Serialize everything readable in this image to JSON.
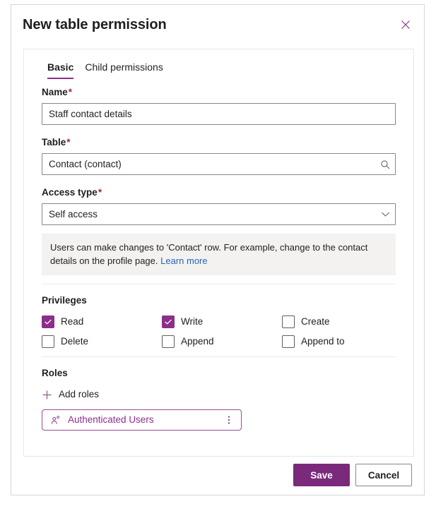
{
  "dialog": {
    "title": "New table permission",
    "close_icon": "close-icon"
  },
  "tabs": [
    {
      "label": "Basic",
      "active": true
    },
    {
      "label": "Child permissions",
      "active": false
    }
  ],
  "form": {
    "name": {
      "label": "Name",
      "required": "*",
      "value": "Staff contact details"
    },
    "table": {
      "label": "Table",
      "required": "*",
      "value": "Contact (contact)",
      "icon": "search-icon"
    },
    "access_type": {
      "label": "Access type",
      "required": "*",
      "value": "Self access",
      "icon": "chevron-down-icon"
    },
    "info": {
      "text": "Users can make changes to 'Contact' row. For example, change to the contact details on the profile page.",
      "link_label": "Learn more"
    }
  },
  "privileges": {
    "title": "Privileges",
    "items": [
      {
        "label": "Read",
        "checked": true
      },
      {
        "label": "Write",
        "checked": true
      },
      {
        "label": "Create",
        "checked": false
      },
      {
        "label": "Delete",
        "checked": false
      },
      {
        "label": "Append",
        "checked": false
      },
      {
        "label": "Append to",
        "checked": false
      }
    ]
  },
  "roles": {
    "title": "Roles",
    "add_label": "Add roles",
    "add_icon": "plus-icon",
    "chips": [
      {
        "label": "Authenticated Users",
        "icon": "person-role-icon",
        "menu_icon": "more-vertical-icon"
      }
    ]
  },
  "footer": {
    "save_label": "Save",
    "cancel_label": "Cancel"
  },
  "colors": {
    "accent": "#8b2f8b",
    "primary_button": "#7b2a7b",
    "required": "#a4262c",
    "link": "#2266bb",
    "info_background": "#f3f2f1"
  }
}
